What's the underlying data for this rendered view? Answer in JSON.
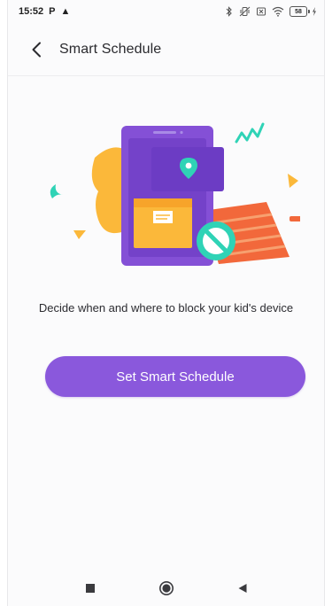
{
  "status_bar": {
    "time": "15:52",
    "left_glyphs": [
      "P",
      "▲"
    ],
    "icons": [
      "bluetooth-icon",
      "vibrate-icon",
      "sim-icon",
      "wifi-icon",
      "battery-icon"
    ],
    "battery_label": "58"
  },
  "header": {
    "title": "Smart Schedule",
    "back_icon": "chevron-left-icon"
  },
  "main": {
    "description": "Decide when and where to block your kid's device",
    "cta_label": "Set Smart Schedule"
  },
  "nav_bar": {
    "icons": [
      "recent-apps-icon",
      "home-icon",
      "back-icon"
    ]
  },
  "colors": {
    "accent": "#8a58dc",
    "phone": "#8450d6",
    "phone_dark": "#6c3cc4",
    "yellow": "#fbb83a",
    "teal": "#2fd3b6",
    "orange": "#f2683b",
    "background": "#fbfbfc"
  }
}
